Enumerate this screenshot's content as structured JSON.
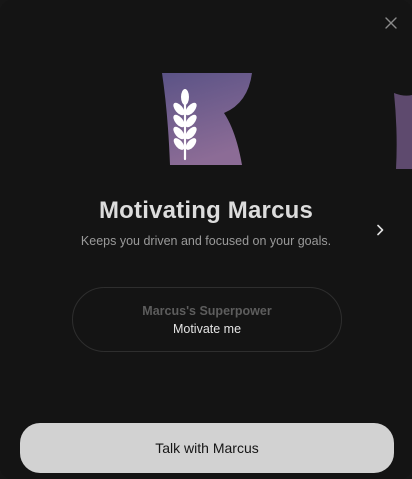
{
  "dialog": {
    "close_icon": "close-icon",
    "next_icon": "chevron-right-icon",
    "persona": {
      "name": "Motivating Marcus",
      "description": "Keeps you driven and focused on your goals.",
      "icon": "wheat-icon",
      "accent_gradient": [
        "#5e5484",
        "#8a6a93"
      ]
    },
    "superpower": {
      "label": "Marcus's Superpower",
      "value": "Motivate me"
    },
    "primary_button": {
      "label": "Talk with Marcus"
    }
  }
}
